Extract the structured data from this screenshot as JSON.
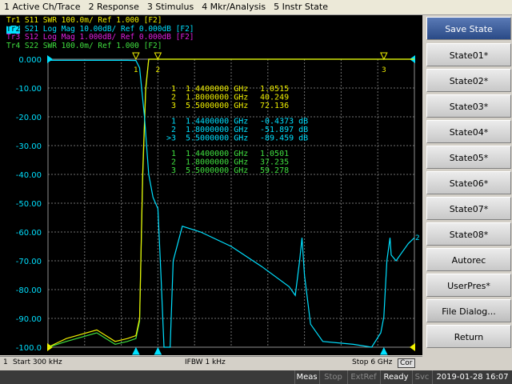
{
  "menu": {
    "items": [
      "1 Active Ch/Trace",
      "2 Response",
      "3 Stimulus",
      "4 Mkr/Analysis",
      "5 Instr State"
    ]
  },
  "traces_header": [
    {
      "id": "Tr1",
      "param": "S11",
      "format": "SWR 100.0m/ Ref 1.000 [F2]",
      "color": "#f0f000",
      "active": false
    },
    {
      "id": "Tr2",
      "param": "S21",
      "format": "Log Mag 10.00dB/ Ref 0.000dB [F2]",
      "color": "#00e0ff",
      "active": true
    },
    {
      "id": "Tr3",
      "param": "S12",
      "format": "Log Mag 1.000dB/ Ref 0.000dB [F2]",
      "color": "#e020e0",
      "active": false
    },
    {
      "id": "Tr4",
      "param": "S22",
      "format": "SWR 100.0m/ Ref 1.000 [F2]",
      "color": "#40e040",
      "active": false
    }
  ],
  "y_axis_labels": [
    "0.000",
    "-10.00",
    "-20.00",
    "-30.00",
    "-40.00",
    "-50.00",
    "-60.00",
    "-70.00",
    "-80.00",
    "-90.00",
    "-100.0"
  ],
  "marker_tables": [
    {
      "color": "#f0f000",
      "rows": [
        {
          "n": "1",
          "freq": "1.4400000 GHz",
          "val": "1.0515"
        },
        {
          "n": "2",
          "freq": "1.8000000 GHz",
          "val": "40.249"
        },
        {
          "n": "3",
          "freq": "5.5000000 GHz",
          "val": "72.136"
        }
      ]
    },
    {
      "color": "#00e0ff",
      "rows": [
        {
          "n": "1",
          "freq": "1.4400000 GHz",
          "val": "-0.4373 dB"
        },
        {
          "n": "2",
          "freq": "1.8000000 GHz",
          "val": "-51.897 dB"
        },
        {
          "n": ">3",
          "freq": "5.5000000 GHz",
          "val": "-89.459 dB"
        }
      ]
    },
    {
      "color": "#40e040",
      "rows": [
        {
          "n": "1",
          "freq": "1.4400000 GHz",
          "val": "1.0501"
        },
        {
          "n": "2",
          "freq": "1.8000000 GHz",
          "val": "37.235"
        },
        {
          "n": "3",
          "freq": "5.5000000 GHz",
          "val": "59.278"
        }
      ]
    }
  ],
  "markers": [
    {
      "label": "1",
      "freq_ghz": 1.44
    },
    {
      "label": "2",
      "freq_ghz": 1.8
    },
    {
      "label": "3",
      "freq_ghz": 5.5
    }
  ],
  "right_end_label": "2",
  "sidebar": {
    "buttons": [
      "Save State",
      "State01*",
      "State02*",
      "State03*",
      "State04*",
      "State05*",
      "State06*",
      "State07*",
      "State08*",
      "Autorec",
      "UserPres*",
      "File Dialog...",
      "Return"
    ]
  },
  "status_bar": {
    "channel": "1",
    "start": "Start 300 kHz",
    "ifbw": "IFBW 1 kHz",
    "stop": "Stop 6 GHz",
    "cor": "Cor"
  },
  "bottom_status": [
    {
      "text": "Meas",
      "on": true
    },
    {
      "text": "Stop",
      "on": false
    },
    {
      "text": "ExtRef",
      "on": false
    },
    {
      "text": "Ready",
      "on": true
    },
    {
      "text": "Svc",
      "on": false
    },
    {
      "text": "2019-01-28 16:07",
      "on": true
    }
  ],
  "chart_data": {
    "type": "line",
    "x_range_ghz": [
      0.0003,
      6.0
    ],
    "ylim": [
      -100,
      0
    ],
    "grid": true,
    "series": [
      {
        "name": "S21",
        "color": "#00e0ff",
        "x": [
          0.0003,
          1.3,
          1.44,
          1.5,
          1.58,
          1.65,
          1.72,
          1.8,
          1.85,
          1.9,
          2.0,
          2.05,
          2.2,
          2.5,
          3.0,
          3.5,
          3.95,
          4.05,
          4.12,
          4.16,
          4.2,
          4.3,
          4.5,
          5.0,
          5.3,
          5.45,
          5.5,
          5.55,
          5.6,
          5.62,
          5.7,
          5.8,
          5.9,
          6.0
        ],
        "y": [
          -0.4,
          -0.4,
          -0.44,
          -3,
          -20,
          -40,
          -48,
          -51.9,
          -75,
          -100,
          -100,
          -70,
          -58,
          -60,
          -65,
          -72,
          -79,
          -82,
          -70,
          -62,
          -75,
          -92,
          -98,
          -99,
          -100,
          -95,
          -89.5,
          -70,
          -62,
          -68,
          -70,
          -67,
          -64,
          -62
        ]
      },
      {
        "name": "S11",
        "color": "#f0f000",
        "x": [
          0.0003,
          0.3,
          0.8,
          1.1,
          1.3,
          1.44,
          1.5,
          1.55,
          1.6,
          1.65,
          6.0
        ],
        "y": [
          -100,
          -97,
          -94,
          -98,
          -97,
          -96,
          -90,
          -40,
          -10,
          0,
          0
        ]
      },
      {
        "name": "S22",
        "color": "#40e040",
        "x": [
          0.0003,
          0.3,
          0.8,
          1.1,
          1.3,
          1.44,
          1.5,
          1.55,
          1.6,
          1.65,
          6.0
        ],
        "y": [
          -100,
          -98,
          -95,
          -99,
          -98,
          -97,
          -91,
          -42,
          -11,
          0,
          0
        ]
      }
    ]
  }
}
